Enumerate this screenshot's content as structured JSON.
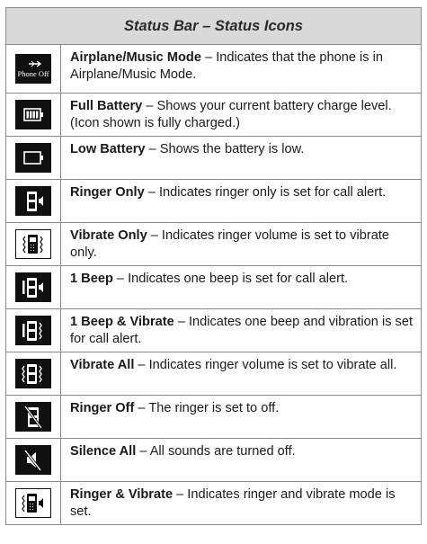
{
  "header": {
    "title": "Status Bar – Status Icons"
  },
  "rows": [
    {
      "icon": "airplane-phone-off-icon",
      "icon_text": "Phone Off",
      "title": "Airplane/Music Mode",
      "desc": " – Indicates that the phone is in Airplane/Music Mode."
    },
    {
      "icon": "full-battery-icon",
      "title": "Full Battery",
      "desc": " – Shows your current battery charge level. (Icon shown is fully charged.)"
    },
    {
      "icon": "low-battery-icon",
      "title": "Low Battery",
      "desc": " – Shows the battery is low."
    },
    {
      "icon": "ringer-only-icon",
      "title": "Ringer Only",
      "desc": " – Indicates ringer only is set for call alert."
    },
    {
      "icon": "vibrate-only-icon",
      "title": "Vibrate Only",
      "desc": " – Indicates ringer volume is set to vibrate only."
    },
    {
      "icon": "one-beep-icon",
      "title": "1 Beep",
      "desc": " – Indicates one beep is set for call alert."
    },
    {
      "icon": "one-beep-vibrate-icon",
      "title": "1 Beep & Vibrate",
      "desc": " – Indicates one beep and vibration is set for call alert."
    },
    {
      "icon": "vibrate-all-icon",
      "title": "Vibrate All",
      "desc": " – Indicates ringer volume is set to vibrate all."
    },
    {
      "icon": "ringer-off-icon",
      "title": "Ringer Off",
      "desc": " – The ringer is set to off."
    },
    {
      "icon": "silence-all-icon",
      "title": "Silence All",
      "desc": " – All sounds are turned off."
    },
    {
      "icon": "ringer-vibrate-icon",
      "title": "Ringer & Vibrate",
      "desc": " – Indicates ringer and vibrate mode is set."
    }
  ]
}
